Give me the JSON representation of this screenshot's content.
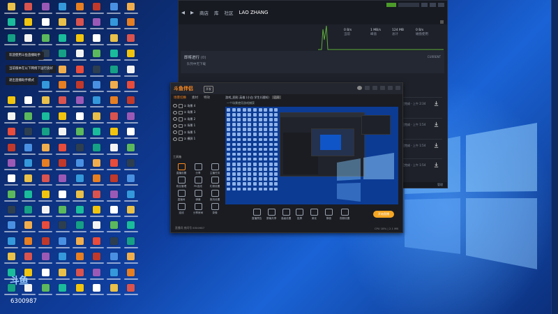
{
  "desktop": {
    "tooltips": [
      "欢迎使用斗鱼直播助手",
      "当前版本在以下网络下运行良好",
      "退出直播助手模式"
    ],
    "corner_logo_text": "斗鱼",
    "room_number": "6300987"
  },
  "steam": {
    "nav": [
      "商店",
      "库",
      "社区",
      "LAO ZHANG"
    ],
    "stats": [
      {
        "value": "0 B/s",
        "label": "当前"
      },
      {
        "value": "1 MB/s",
        "label": "峰值"
      },
      {
        "value": "124 MB",
        "label": "总计"
      },
      {
        "value": "0 B/s",
        "label": "磁盘使用"
      }
    ],
    "section_title": "即将进行",
    "section_count": "(0)",
    "section_subtitle": "队列中无下载",
    "section_right": "CURRENT",
    "rows": [
      "已完成 - 上午 2:34",
      "已完成 - 上午 1:54",
      "已完成 - 上午 1:54",
      "已完成 - 上午 1:54"
    ],
    "bottom_label": "管理"
  },
  "recorder": {
    "logo": "斗鱼伴侣",
    "badge": "开发",
    "tabs": [
      "场景切换",
      "素材",
      "特效"
    ],
    "active_tab": "场景切换",
    "header": "游戏_图形 英雄 (小白 学生)(通知)",
    "header_tag": "已开",
    "subheader": "一个场景使用游戏捕获",
    "scenes": [
      "① 场景 4",
      "① 场景 3",
      "① 场景 2",
      "① 场景 1",
      "① 场景 5",
      "① 横屏 1"
    ],
    "tools_title": "工具箱",
    "tools": [
      "直播设置",
      "分享",
      "主播任务",
      "粉丝管理",
      "PK连线",
      "礼物设置",
      "直播间",
      "弹幕",
      "推流设置",
      "连线",
      "分享房间",
      "录像"
    ],
    "toolbar": [
      "直播预告",
      "屏幕共享",
      "高级设置",
      "投屏",
      "美化",
      "静音",
      "视频设置"
    ],
    "start_button": "开始直播",
    "status_left": "直播间 房间号 6300987",
    "status_right": "CPU 18% | 2.1 MB"
  }
}
